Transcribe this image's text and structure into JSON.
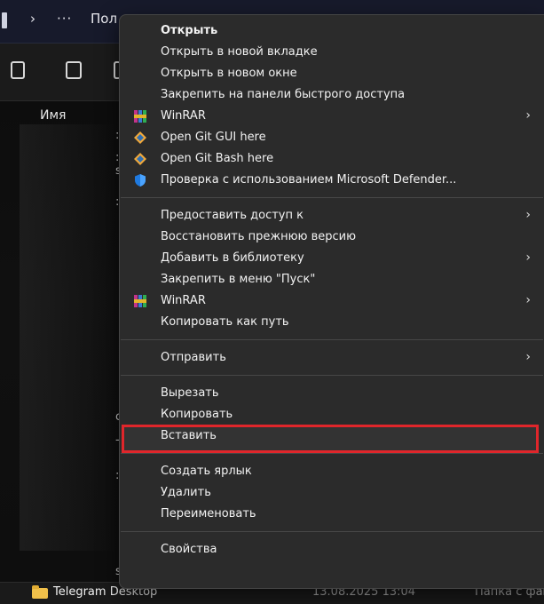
{
  "titlebar": {
    "nav_arrow": "›",
    "ellipsis": "···",
    "location_partial": "Пол"
  },
  "toolbar": {
    "icons": [
      "copy-icon",
      "rename-icon",
      "share-icon"
    ]
  },
  "file_list": {
    "column_name": "Имя",
    "fragments": [
      ":",
      ":",
      "s",
      ":",
      "c",
      "-",
      ":",
      "s"
    ]
  },
  "bottom_row": {
    "name": "Telegram Desktop",
    "date": "13.08.2025 13:04",
    "type": "Папка с фай"
  },
  "context_menu": {
    "groups": [
      [
        {
          "label": "Открыть",
          "bold": true
        },
        {
          "label": "Открыть в новой вкладке"
        },
        {
          "label": "Открыть в новом окне"
        },
        {
          "label": "Закрепить на панели быстрого доступа"
        },
        {
          "label": "WinRAR",
          "icon": "winrar-icon",
          "submenu": true
        },
        {
          "label": "Open Git GUI here",
          "icon": "git-icon"
        },
        {
          "label": "Open Git Bash here",
          "icon": "git-icon"
        },
        {
          "label": "Проверка с использованием Microsoft Defender...",
          "icon": "defender-shield-icon"
        }
      ],
      [
        {
          "label": "Предоставить доступ к",
          "submenu": true
        },
        {
          "label": "Восстановить прежнюю версию"
        },
        {
          "label": "Добавить в библиотеку",
          "submenu": true
        },
        {
          "label": "Закрепить в меню \"Пуск\""
        },
        {
          "label": "WinRAR",
          "icon": "winrar-icon",
          "submenu": true
        },
        {
          "label": "Копировать как путь"
        }
      ],
      [
        {
          "label": "Отправить",
          "submenu": true
        }
      ],
      [
        {
          "label": "Вырезать"
        },
        {
          "label": "Копировать",
          "highlighted": true
        },
        {
          "label": "Вставить"
        }
      ],
      [
        {
          "label": "Создать ярлык"
        },
        {
          "label": "Удалить"
        },
        {
          "label": "Переименовать"
        }
      ],
      [
        {
          "label": "Свойства"
        }
      ]
    ],
    "submenu_arrow": "›"
  },
  "colors": {
    "menu_bg": "#2b2b2b",
    "highlight_border": "#e0262b",
    "folder": "#f0c04a"
  }
}
